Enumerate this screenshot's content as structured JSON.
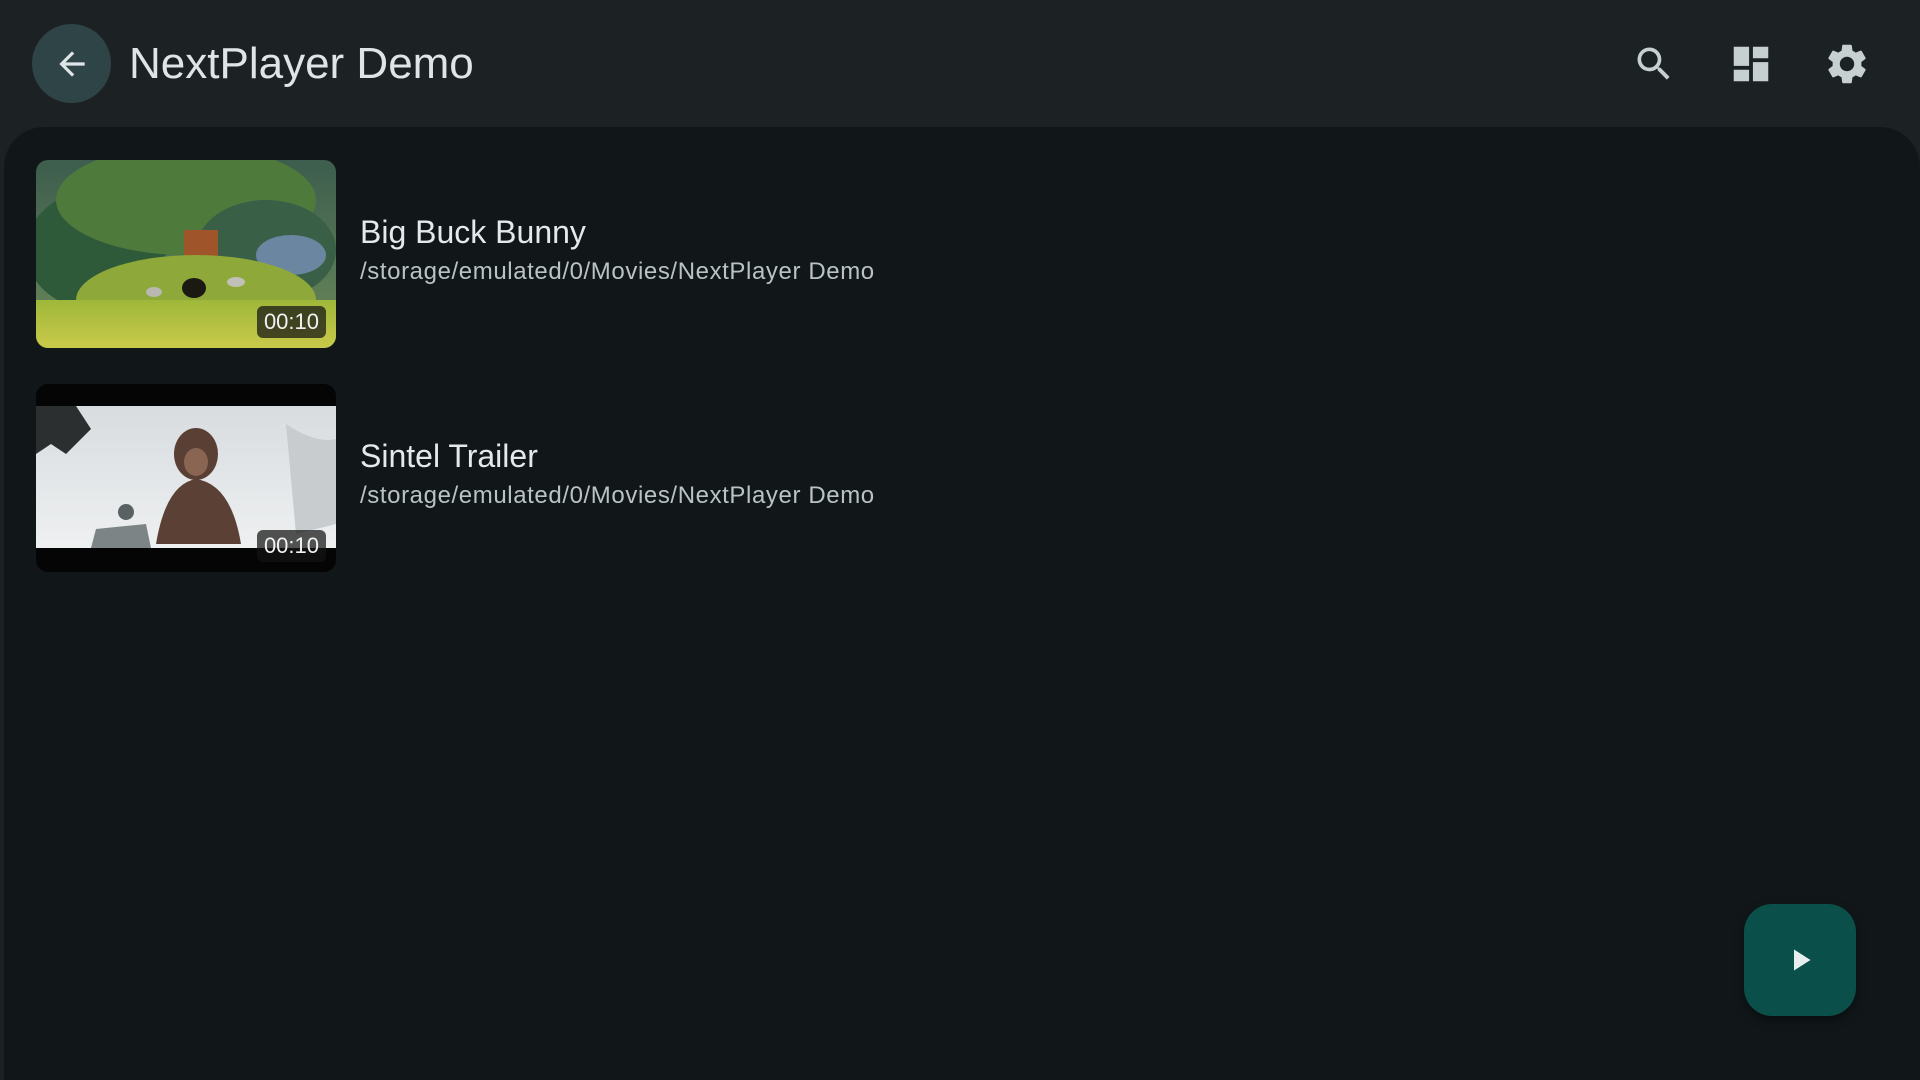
{
  "app": {
    "title": "NextPlayer Demo"
  },
  "toolbar": {
    "back_icon": "arrow-back-icon",
    "search_icon": "search-icon",
    "layout_icon": "dashboard-icon",
    "settings_icon": "gear-icon"
  },
  "videos": [
    {
      "title": "Big Buck Bunny",
      "path": "/storage/emulated/0/Movies/NextPlayer Demo",
      "duration": "00:10"
    },
    {
      "title": "Sintel Trailer",
      "path": "/storage/emulated/0/Movies/NextPlayer Demo",
      "duration": "00:10"
    }
  ],
  "fab": {
    "icon": "play-icon"
  },
  "colors": {
    "background": "#1c2224",
    "content_background": "#111719",
    "back_button": "#2f4446",
    "fab": "#0b4f4b",
    "icon": "#c7d0d1"
  }
}
